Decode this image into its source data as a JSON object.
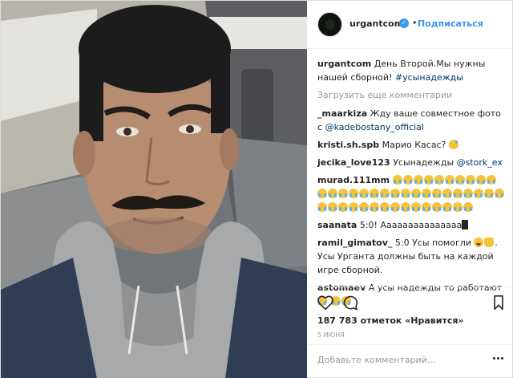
{
  "header": {
    "username": "urgantcom",
    "separator": "•",
    "follow_label": "Подписаться"
  },
  "caption": {
    "username": "urgantcom",
    "text": "День Второй.Мы нужны нашей сборной!",
    "hashtag": "#усынадежды"
  },
  "load_more_label": "Загрузить еще комментарии",
  "comments": [
    {
      "username": "_maarkiza",
      "text": "Жду ваше совместное фото с",
      "mention": "@kadebostany_official"
    },
    {
      "username": "kristi.sh.spb",
      "text": "Марио Касас?"
    },
    {
      "username": "jecika_love123",
      "text": "Усынадежды",
      "mention": "@stork_ex"
    },
    {
      "username": "murad.111mm"
    },
    {
      "username": "saanata",
      "text": "5:0! Ааааааааааааааа"
    },
    {
      "username": "ramil_gimatov_",
      "text": "5:0 Усы помогли",
      "text2": ". Усы Урганта должны быть на каждой игре сборной."
    },
    {
      "username": "astomaev",
      "text": "А усы надежды то работают"
    }
  ],
  "likes_text": "187 783 отметок «Нравится»",
  "date_text": "5 июня",
  "add_comment_placeholder": "Добавьте комментарий...",
  "icons": {
    "heart": "heart-icon",
    "comment": "comment-icon",
    "bookmark": "bookmark-icon",
    "verified": "verified-badge-icon",
    "options": "more-options-icon"
  }
}
